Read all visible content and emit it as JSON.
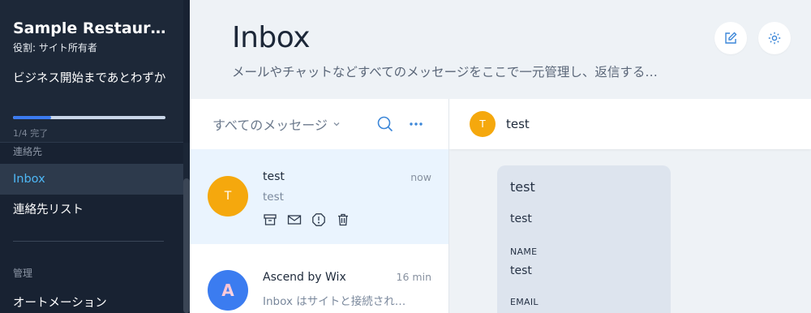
{
  "sidebar": {
    "site_name": "Sample Restaur…",
    "role": "役割: サイト所有者",
    "onboarding_text": "ビジネス開始まであとわずか",
    "progress": {
      "fraction": 0.25,
      "label": "1/4 完了"
    },
    "section_contacts": "連絡先",
    "items": [
      {
        "label": "Inbox",
        "active": true
      },
      {
        "label": "連絡先リスト",
        "active": false
      }
    ],
    "section_manage": "管理",
    "items_manage": [
      {
        "label": "オートメーション"
      }
    ]
  },
  "header": {
    "title": "Inbox",
    "subtitle": "メールやチャットなどすべてのメッセージをここで一元管理し、返信する…",
    "icons": [
      "compose-icon",
      "settings-icon"
    ]
  },
  "list": {
    "filter_label": "すべてのメッセージ",
    "conversations": [
      {
        "initial": "T",
        "name": "test",
        "time": "now",
        "preview": "test",
        "avatar_color": "#f5a80d",
        "selected": true,
        "actions": [
          "archive-icon",
          "mail-icon",
          "spam-icon",
          "trash-icon"
        ]
      },
      {
        "initial": "A",
        "name": "Ascend by Wix",
        "time": "16 min",
        "preview": "Inbox はサイトと接続され…",
        "avatar_color": "#3b7cf0",
        "selected": false
      }
    ]
  },
  "chat": {
    "contact_initial": "T",
    "contact_name": "test",
    "message": {
      "title": "test",
      "body": "test",
      "name_label": "NAME",
      "name_value": "test",
      "email_label": "EMAIL"
    }
  },
  "colors": {
    "sidebar_bg": "#182232",
    "accent": "#4eb7f5",
    "avatar_orange": "#f5a80d",
    "progress": "#3b7bf0"
  }
}
